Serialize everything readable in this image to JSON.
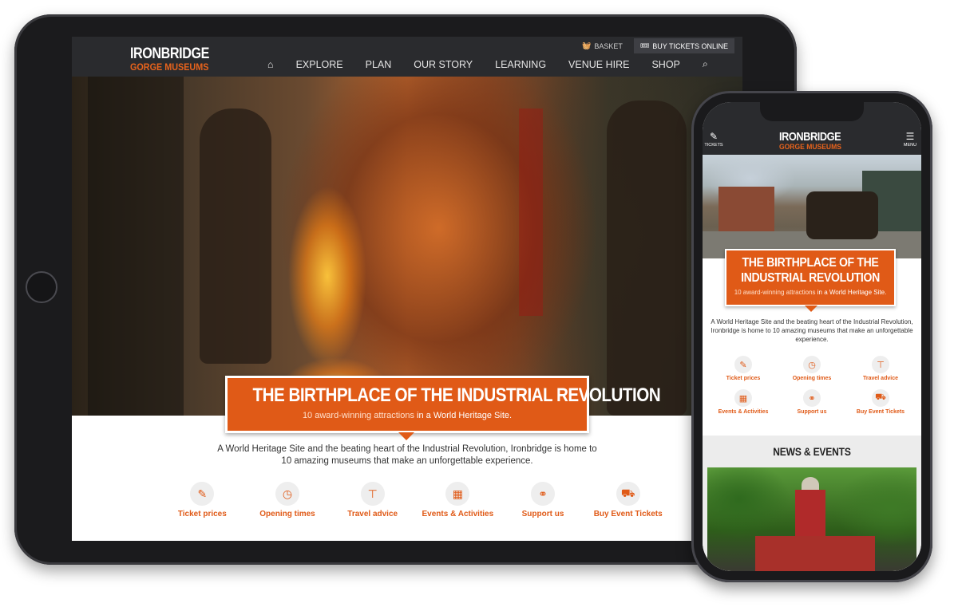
{
  "brand": {
    "line1": "IRONBRIDGE",
    "line2": "GORGE MUSEUMS",
    "accent": "#e05a17"
  },
  "tablet": {
    "utility": {
      "basket": "BASKET",
      "buy": "BUY TICKETS ONLINE"
    },
    "nav": [
      "EXPLORE",
      "PLAN",
      "OUR STORY",
      "LEARNING",
      "VENUE HIRE",
      "SHOP"
    ],
    "hero": {
      "title": "THE BIRTHPLACE OF THE INDUSTRIAL REVOLUTION",
      "sub_pre": "10 award-winning attractions",
      "sub_hl": " in a World Heritage Site."
    },
    "intro": "A World Heritage Site and the beating heart of the Industrial Revolution, Ironbridge is home to 10 amazing museums that make an unforgettable experience.",
    "quicklinks": [
      {
        "label": "Ticket prices",
        "icon": "ticket-icon"
      },
      {
        "label": "Opening times",
        "icon": "clock-icon"
      },
      {
        "label": "Travel advice",
        "icon": "signpost-icon"
      },
      {
        "label": "Events & Activities",
        "icon": "calendar-icon"
      },
      {
        "label": "Support us",
        "icon": "handshake-icon"
      },
      {
        "label": "Buy Event Tickets",
        "icon": "cart-icon"
      }
    ]
  },
  "phone": {
    "tickets_label": "TICKETS",
    "menu_label": "MENU",
    "hero": {
      "title": "THE BIRTHPLACE OF THE INDUSTRIAL REVOLUTION",
      "sub_pre": "10 award-winning attractions",
      "sub_hl": " in a World Heritage Site."
    },
    "intro": "A World Heritage Site and the beating heart of the Industrial Revolution, Ironbridge is home to 10 amazing museums that make an unforgettable experience.",
    "quicklinks": [
      {
        "label": "Ticket prices",
        "icon": "ticket-icon"
      },
      {
        "label": "Opening times",
        "icon": "clock-icon"
      },
      {
        "label": "Travel advice",
        "icon": "signpost-icon"
      },
      {
        "label": "Events & Activities",
        "icon": "calendar-icon"
      },
      {
        "label": "Support us",
        "icon": "handshake-icon"
      },
      {
        "label": "Buy Event Tickets",
        "icon": "cart-icon"
      }
    ],
    "news_title": "NEWS & EVENTS"
  }
}
